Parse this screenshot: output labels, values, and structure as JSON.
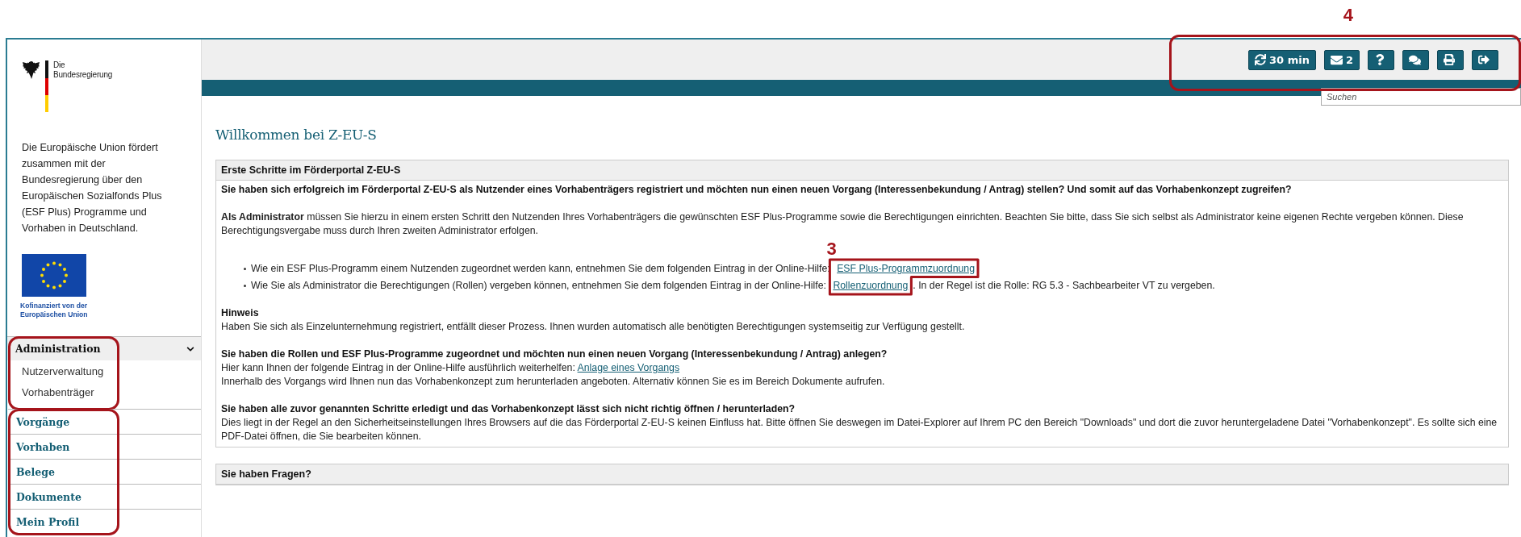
{
  "sidebar": {
    "logo": {
      "line1": "Die",
      "line2": "Bundesregierung"
    },
    "intro": "Die Europäische Union fördert zusammen mit der Bundesregierung über den Europäischen Sozialfonds Plus (ESF Plus) Programme und Vorhaben in Deutschland.",
    "eu_caption": [
      "Kofinanziert von der",
      "Europäischen Union"
    ],
    "nav_groups": [
      {
        "annotated": true,
        "items": [
          {
            "label": "Administration",
            "expanded": true,
            "children": [
              {
                "label": "Nutzerverwaltung"
              },
              {
                "label": "Vorhabenträger"
              }
            ]
          }
        ]
      },
      {
        "annotated": true,
        "items": [
          {
            "label": "Vorgänge"
          },
          {
            "label": "Vorhaben"
          },
          {
            "label": "Belege"
          },
          {
            "label": "Dokumente"
          },
          {
            "label": "Mein Profil"
          }
        ]
      }
    ]
  },
  "toolbar": {
    "annotation": "4",
    "buttons": [
      {
        "kind": "refresh",
        "label": "30 min"
      },
      {
        "kind": "mail",
        "label": "2"
      },
      {
        "kind": "help"
      },
      {
        "kind": "chat"
      },
      {
        "kind": "print"
      },
      {
        "kind": "logout"
      }
    ]
  },
  "search": {
    "placeholder": "Suchen"
  },
  "page_title": "Willkommen bei Z-EU-S",
  "panels": [
    {
      "title": "Erste Schritte im Förderportal Z-EU-S",
      "sections": [
        {
          "heading": "Sie haben sich erfolgreich im Förderportal Z-EU-S als Nutzender eines Vorhabenträgers registriert und möchten nun einen neuen Vorgang (Interessenbekundung / Antrag) stellen? Und somit auf das Vorhabenkonzept zugreifen?"
        },
        {
          "lines": [
            [
              {
                "kind": "text",
                "text": "**Als Administrator** müssen Sie hierzu in einem ersten Schritt den Nutzenden Ihres Vorhabenträgers die gewünschten ESF Plus-Programme sowie die Berechtigungen einrichten. Beachten Sie bitte, dass Sie sich selbst als Administrator keine eigenen Rechte vergeben können. Diese Berechtigungsvergabe muss durch Ihren zweiten Administrator erfolgen."
              }
            ]
          ],
          "bullets_annotation": "3",
          "bullets": [
            [
              {
                "kind": "text",
                "text": "Wie ein ESF Plus-Programm einem Nutzenden zugeordnet werden kann, entnehmen Sie dem folgenden Eintrag in der Online-Hilfe: "
              },
              {
                "kind": "link",
                "text": "ESF Plus-Programmzuordnung"
              }
            ],
            [
              {
                "kind": "text",
                "text": "Wie Sie als Administrator die Berechtigungen (Rollen) vergeben können, entnehmen Sie dem folgenden Eintrag in der Online-Hilfe: "
              },
              {
                "kind": "link",
                "text": "Rollenzuordnung"
              },
              {
                "kind": "text",
                "text": ". In der Regel ist die Rolle: RG 5.3 - Sachbearbeiter VT zu vergeben."
              }
            ]
          ]
        },
        {
          "heading": "Hinweis",
          "lines": [
            [
              {
                "kind": "text",
                "text": "Haben Sie sich als Einzelunternehmung registriert, entfällt dieser Prozess. Ihnen wurden automatisch alle benötigten Berechtigungen systemseitig zur Verfügung gestellt."
              }
            ]
          ]
        },
        {
          "heading": "Sie haben die Rollen und ESF Plus-Programme zugeordnet und möchten nun einen neuen Vorgang (Interessenbekundung / Antrag) anlegen?",
          "lines": [
            [
              {
                "kind": "text",
                "text": "Hier kann Ihnen der folgende Eintrag in der Online-Hilfe ausführlich weiterhelfen: "
              },
              {
                "kind": "link",
                "text": "Anlage eines Vorgangs"
              }
            ],
            [
              {
                "kind": "text",
                "text": "Innerhalb des Vorgangs wird Ihnen nun das Vorhabenkonzept zum herunterladen angeboten. Alternativ können Sie es im Bereich Dokumente aufrufen."
              }
            ]
          ]
        },
        {
          "heading": "Sie haben alle zuvor genannten Schritte erledigt und das Vorhabenkonzept lässt sich nicht richtig öffnen / herunterladen?",
          "lines": [
            [
              {
                "kind": "text",
                "text": "Dies liegt in der Regel an den Sicherheitseinstellungen Ihres Browsers auf die das Förderportal Z-EU-S keinen Einfluss hat. Bitte öffnen Sie deswegen im Datei-Explorer auf Ihrem PC den Bereich \"Downloads\" und dort die zuvor heruntergeladene Datei \"Vorhabenkonzept\". Es sollte sich eine PDF-Datei öffnen, die Sie bearbeiten können."
              }
            ]
          ]
        }
      ]
    },
    {
      "title": "Sie haben Fragen?"
    }
  ]
}
